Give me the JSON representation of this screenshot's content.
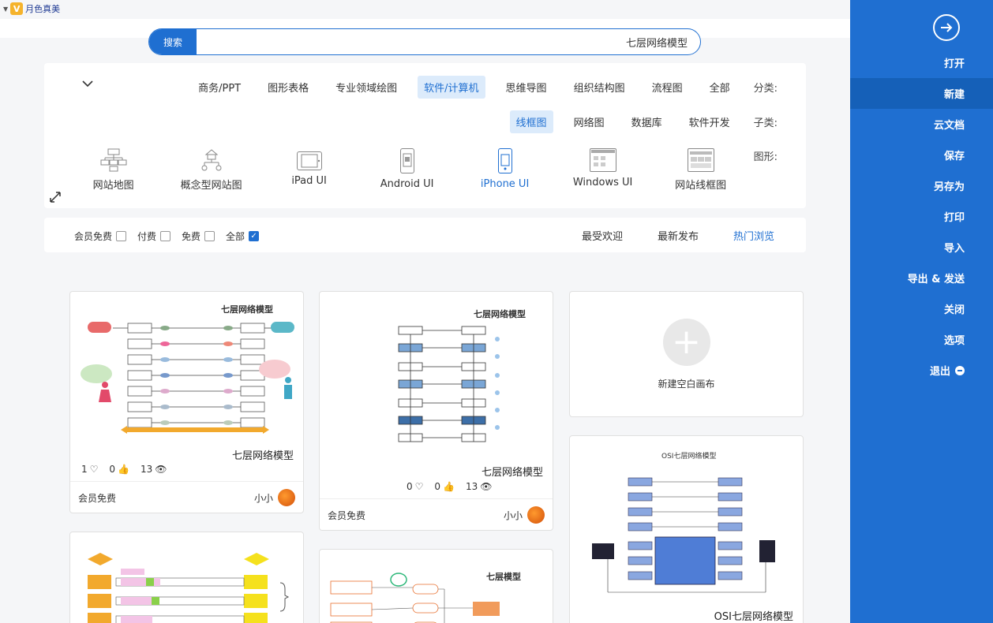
{
  "user": {
    "name": "月色真美"
  },
  "search": {
    "value": "七层网络模型",
    "button": "搜索"
  },
  "category": {
    "label": "分类:",
    "items": [
      "全部",
      "流程图",
      "组织结构图",
      "思维导图",
      "软件/计算机",
      "专业领域绘图",
      "图形表格",
      "商务/PPT"
    ],
    "active": "软件/计算机"
  },
  "subcategory": {
    "label": "子类:",
    "items": [
      "软件开发",
      "数据库",
      "网络图",
      "线框图"
    ],
    "active": "线框图"
  },
  "shapes": {
    "label": "图形:",
    "items": [
      "网站线框图",
      "Windows UI",
      "iPhone UI",
      "Android UI",
      "iPad UI",
      "概念型网站图",
      "网站地图"
    ],
    "active": "iPhone UI"
  },
  "sort": {
    "items": [
      "热门浏览",
      "最新发布",
      "最受欢迎"
    ],
    "active": "热门浏览"
  },
  "filters": {
    "items": [
      "全部",
      "免费",
      "付费",
      "会员免费"
    ],
    "checked": "全部"
  },
  "new_canvas": {
    "label": "新建空白画布"
  },
  "cards": [
    {
      "title": "七层网络模型",
      "views": "13",
      "likes": "0",
      "favs": "1",
      "author": "小小",
      "price": "会员免费",
      "thumb_title": "七层网络模型"
    },
    {
      "title": "七层网络模型",
      "views": "13",
      "likes": "0",
      "favs": "0",
      "author": "小小",
      "price": "会员免费",
      "thumb_title": "七层网络模型"
    },
    {
      "title": "OSI七层网络模型",
      "thumb_title": "OSI七层网络模型"
    },
    {
      "thumb_title": "七层模型"
    }
  ],
  "sidebar": {
    "items": [
      "打开",
      "新建",
      "云文档",
      "保存",
      "另存为",
      "打印",
      "导入",
      "导出 & 发送",
      "关闭",
      "选项",
      "退出"
    ],
    "active": "新建"
  }
}
